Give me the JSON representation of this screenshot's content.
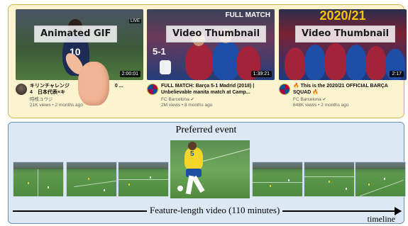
{
  "videos": [
    {
      "overlay_label": "Animated GIF",
      "duration": "2:00:01",
      "title_line1": "キリンチャレンジ",
      "title_line1_tail": "0 ...",
      "title_line2": "4　日本代表×キ",
      "channel": "時枝ユウジ",
      "stats": "21K views • 2 months ago",
      "shirt_number": "10"
    },
    {
      "overlay_label": "Video Thumbnail",
      "duration": "1:39:21",
      "title_line1": "FULL MATCH: Barça 5-1 Madrid (2018) |",
      "title_line2": "Unbelievable manita match at Camp...",
      "channel": "FC Barcelona",
      "stats": "2M views • 8 months ago",
      "thumb_text": "FULL MATCH",
      "thumb_score": "5-1"
    },
    {
      "overlay_label": "Video Thumbnail",
      "duration": "2:17",
      "title_line1": "🔥 This is the 2020/21 OFFICIAL BARÇA",
      "title_line2": "SQUAD 🔥",
      "channel": "FC Barcelona",
      "stats": "848K views • 2 months ago",
      "thumb_text": "2020/21"
    }
  ],
  "verified_mark": "✔",
  "bottom": {
    "preferred_label": "Preferred event",
    "feature_label": "Feature-length video (110 minutes)",
    "timeline_label": "timeline"
  }
}
